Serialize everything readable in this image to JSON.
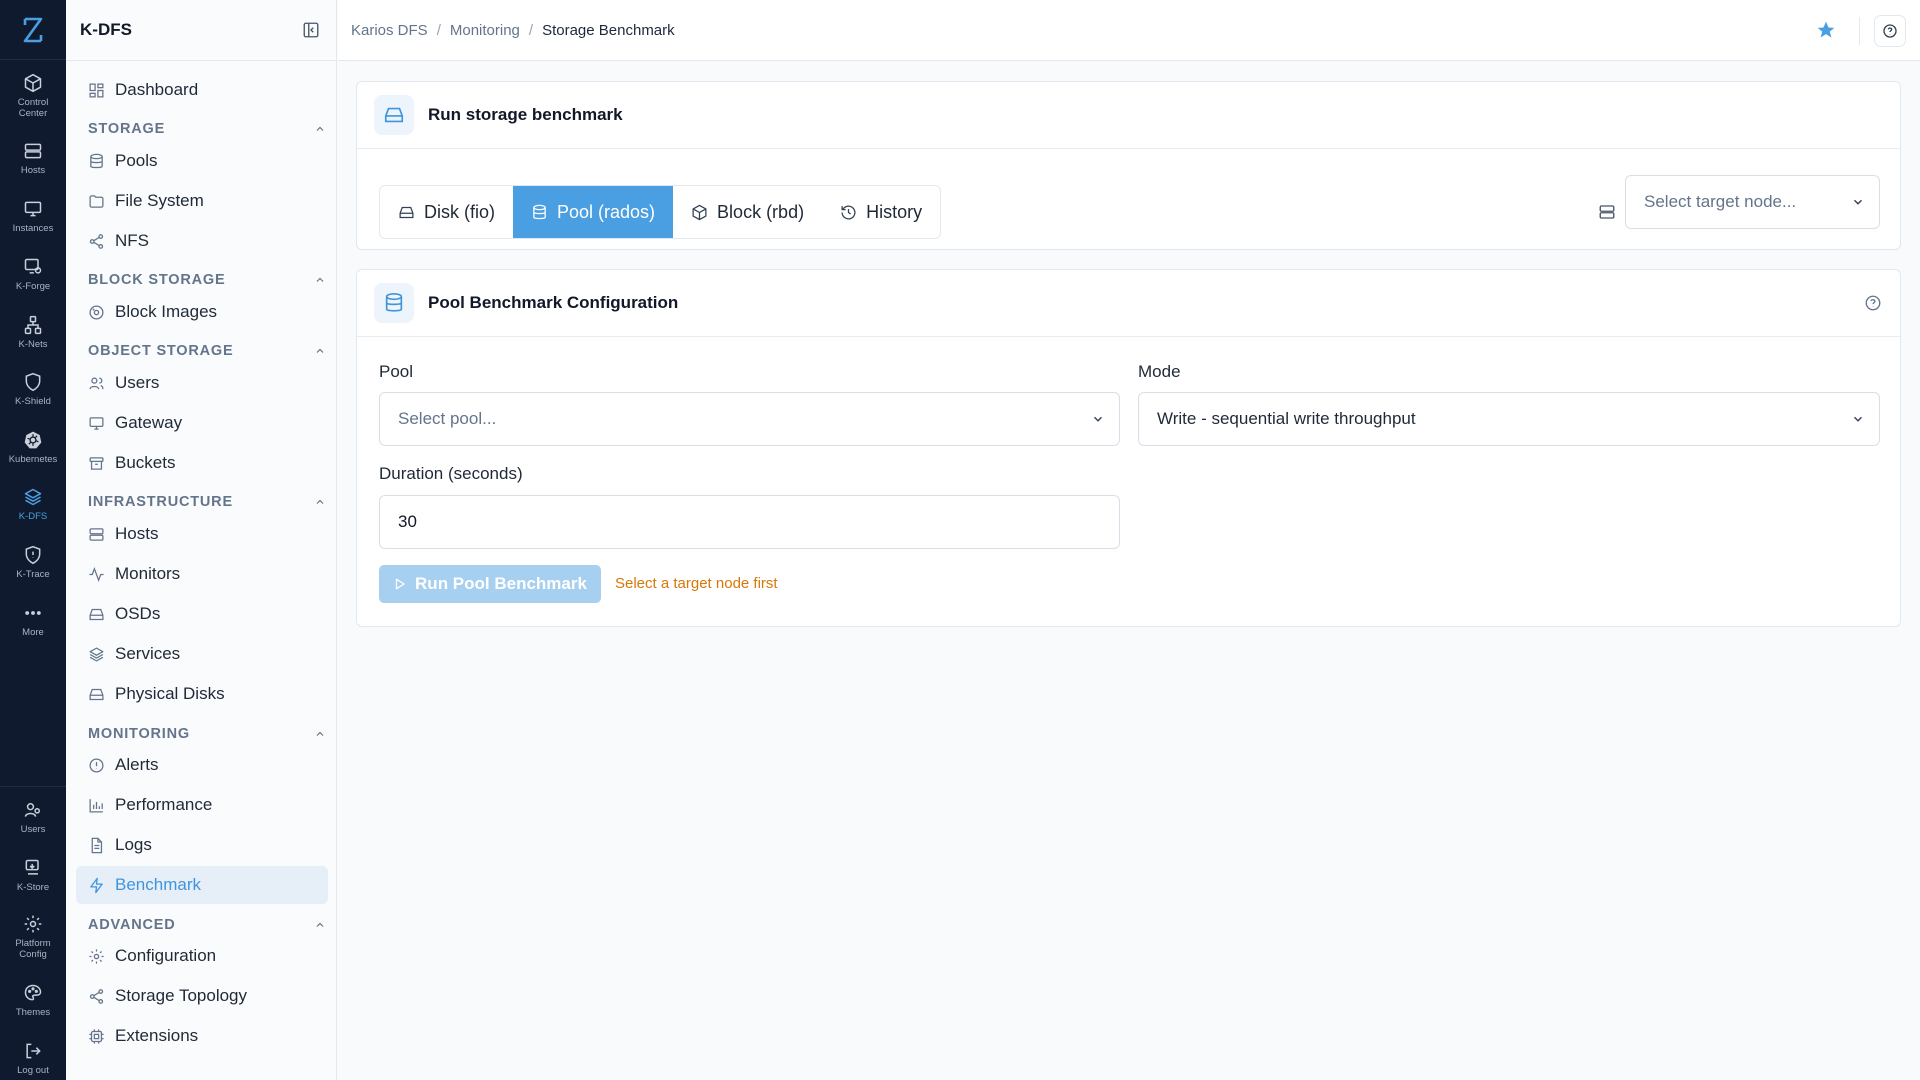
{
  "colors": {
    "accent": "#4a9fe3",
    "rail_bg": "#0f1a2e",
    "warning": "#d97706",
    "star": "#4a9fe3"
  },
  "rail": {
    "items": [
      {
        "label": "Control Center",
        "icon": "box-icon"
      },
      {
        "label": "Hosts",
        "icon": "server-icon"
      },
      {
        "label": "Instances",
        "icon": "monitor-icon"
      },
      {
        "label": "K-Forge",
        "icon": "forge-icon"
      },
      {
        "label": "K-Nets",
        "icon": "network-icon"
      },
      {
        "label": "K-Shield",
        "icon": "shield-icon"
      },
      {
        "label": "Kubernetes",
        "icon": "kubernetes-icon"
      },
      {
        "label": "K-DFS",
        "icon": "layers-icon",
        "active": true
      },
      {
        "label": "K-Trace",
        "icon": "trace-shield-icon"
      },
      {
        "label": "More",
        "icon": "more-icon"
      }
    ],
    "bottom": [
      {
        "label": "Users",
        "icon": "users-icon"
      },
      {
        "label": "K-Store",
        "icon": "store-icon"
      },
      {
        "label": "Platform Config",
        "icon": "gear-icon"
      },
      {
        "label": "Themes",
        "icon": "palette-icon"
      },
      {
        "label": "Log out",
        "icon": "logout-icon"
      }
    ]
  },
  "sidebar": {
    "title": "K-DFS",
    "dashboard": "Dashboard",
    "sections": {
      "storage": "STORAGE",
      "block_storage": "BLOCK STORAGE",
      "object_storage": "OBJECT STORAGE",
      "infrastructure": "INFRASTRUCTURE",
      "monitoring": "MONITORING",
      "advanced": "ADVANCED"
    },
    "items": {
      "pools": "Pools",
      "file_system": "File System",
      "nfs": "NFS",
      "block_images": "Block Images",
      "users": "Users",
      "gateway": "Gateway",
      "buckets": "Buckets",
      "hosts": "Hosts",
      "monitors": "Monitors",
      "osds": "OSDs",
      "services": "Services",
      "physical_disks": "Physical Disks",
      "alerts": "Alerts",
      "performance": "Performance",
      "logs": "Logs",
      "benchmark": "Benchmark",
      "configuration": "Configuration",
      "storage_topology": "Storage Topology",
      "extensions": "Extensions"
    }
  },
  "breadcrumb": {
    "item1": "Karios DFS",
    "item2": "Monitoring",
    "current": "Storage Benchmark",
    "sep": "/"
  },
  "run_card": {
    "title": "Run storage benchmark",
    "tabs": [
      {
        "label": "Disk (fio)",
        "icon": "disk-icon"
      },
      {
        "label": "Pool (rados)",
        "icon": "database-icon",
        "active": true
      },
      {
        "label": "Block (rbd)",
        "icon": "cube-icon"
      },
      {
        "label": "History",
        "icon": "history-icon"
      }
    ],
    "target_node_placeholder": "Select target node..."
  },
  "config_card": {
    "title": "Pool Benchmark Configuration",
    "pool_label": "Pool",
    "pool_placeholder": "Select pool...",
    "mode_label": "Mode",
    "mode_value": "Write - sequential write throughput",
    "duration_label": "Duration (seconds)",
    "duration_value": "30",
    "run_button": "Run Pool Benchmark",
    "hint": "Select a target node first"
  }
}
